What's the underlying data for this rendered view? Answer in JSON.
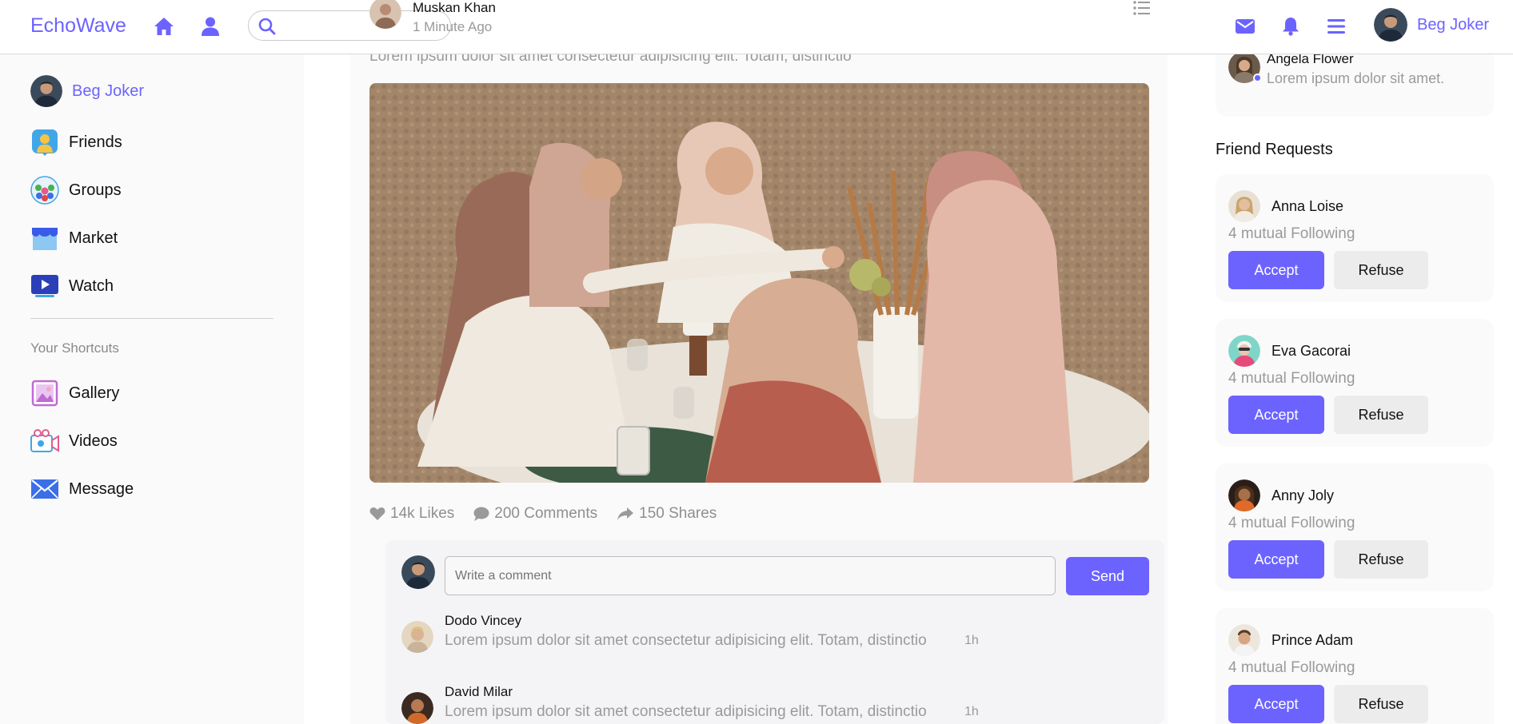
{
  "header": {
    "brand": "EchoWave",
    "search_placeholder": "",
    "user_name": "Beg Joker"
  },
  "sidebar": {
    "profile_name": "Beg Joker",
    "items": [
      {
        "label": "Friends",
        "icon": "friends-icon"
      },
      {
        "label": "Groups",
        "icon": "groups-icon"
      },
      {
        "label": "Market",
        "icon": "market-icon"
      },
      {
        "label": "Watch",
        "icon": "watch-icon"
      }
    ],
    "shortcuts_title": "Your Shortcuts",
    "shortcuts": [
      {
        "label": "Gallery",
        "icon": "gallery-icon"
      },
      {
        "label": "Videos",
        "icon": "videos-icon"
      },
      {
        "label": "Message",
        "icon": "message-icon"
      }
    ]
  },
  "post": {
    "author": "Muskan Khan",
    "time": "1 Minute Ago",
    "text": "Lorem ipsum dolor sit amet consectetur adipisicing elit. Totam, distinctio",
    "likes": "14k Likes",
    "comments": "200 Comments",
    "shares": "150 Shares",
    "comment_placeholder": "Write a comment",
    "send_label": "Send",
    "comment_list": [
      {
        "name": "Dodo Vincey",
        "text": "Lorem ipsum dolor sit amet consectetur adipisicing elit. Totam, distinctio",
        "time": "1h"
      },
      {
        "name": "David Milar",
        "text": "Lorem ipsum dolor sit amet consectetur adipisicing elit. Totam, distinctio",
        "time": "1h"
      }
    ]
  },
  "online": {
    "name": "Angela Flower",
    "text": "Lorem ipsum dolor sit amet."
  },
  "friend_requests": {
    "title": "Friend Requests",
    "accept_label": "Accept",
    "refuse_label": "Refuse",
    "list": [
      {
        "name": "Anna Loise",
        "mutual": "4 mutual Following"
      },
      {
        "name": "Eva Gacorai",
        "mutual": "4 mutual Following"
      },
      {
        "name": "Anny Joly",
        "mutual": "4 mutual Following"
      },
      {
        "name": "Prince Adam",
        "mutual": "4 mutual Following"
      }
    ]
  },
  "colors": {
    "accent": "#6c63ff",
    "muted_text": "#9a9a9a",
    "card_bg": "#fafafa"
  }
}
